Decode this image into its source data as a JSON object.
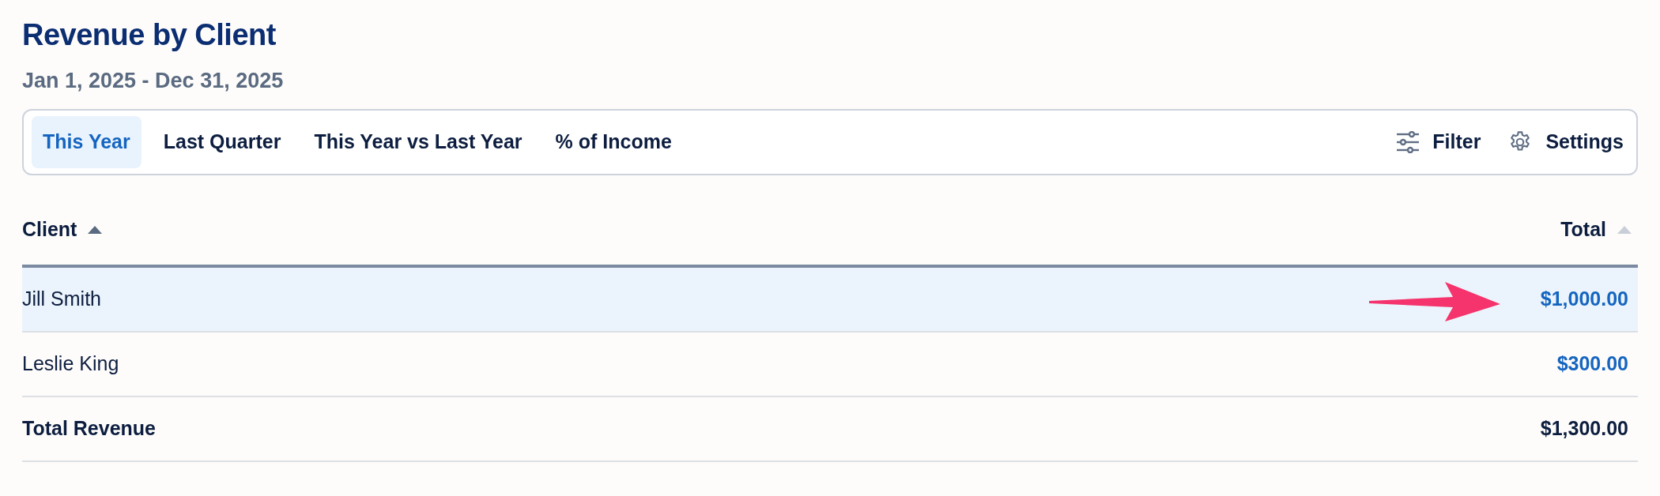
{
  "title": "Revenue by Client",
  "date_range": "Jan 1, 2025 - Dec 31, 2025",
  "tabs": [
    {
      "label": "This Year",
      "selected": true
    },
    {
      "label": "Last Quarter",
      "selected": false
    },
    {
      "label": "This Year vs Last Year",
      "selected": false
    },
    {
      "label": "% of Income",
      "selected": false
    }
  ],
  "actions": [
    {
      "kind": "filter",
      "label": "Filter"
    },
    {
      "kind": "settings",
      "label": "Settings"
    }
  ],
  "table": {
    "columns": [
      {
        "label": "Client",
        "sorted": true
      },
      {
        "label": "Total",
        "sorted": false
      }
    ],
    "rows": [
      {
        "kind": "client",
        "client": "Jill Smith",
        "total": "$1,000.00",
        "selected": true,
        "annotated": true
      },
      {
        "kind": "client",
        "client": "Leslie King",
        "total": "$300.00",
        "selected": false,
        "annotated": false
      },
      {
        "kind": "total",
        "client": "Total Revenue",
        "total": "$1,300.00",
        "selected": false,
        "annotated": false
      }
    ]
  }
}
